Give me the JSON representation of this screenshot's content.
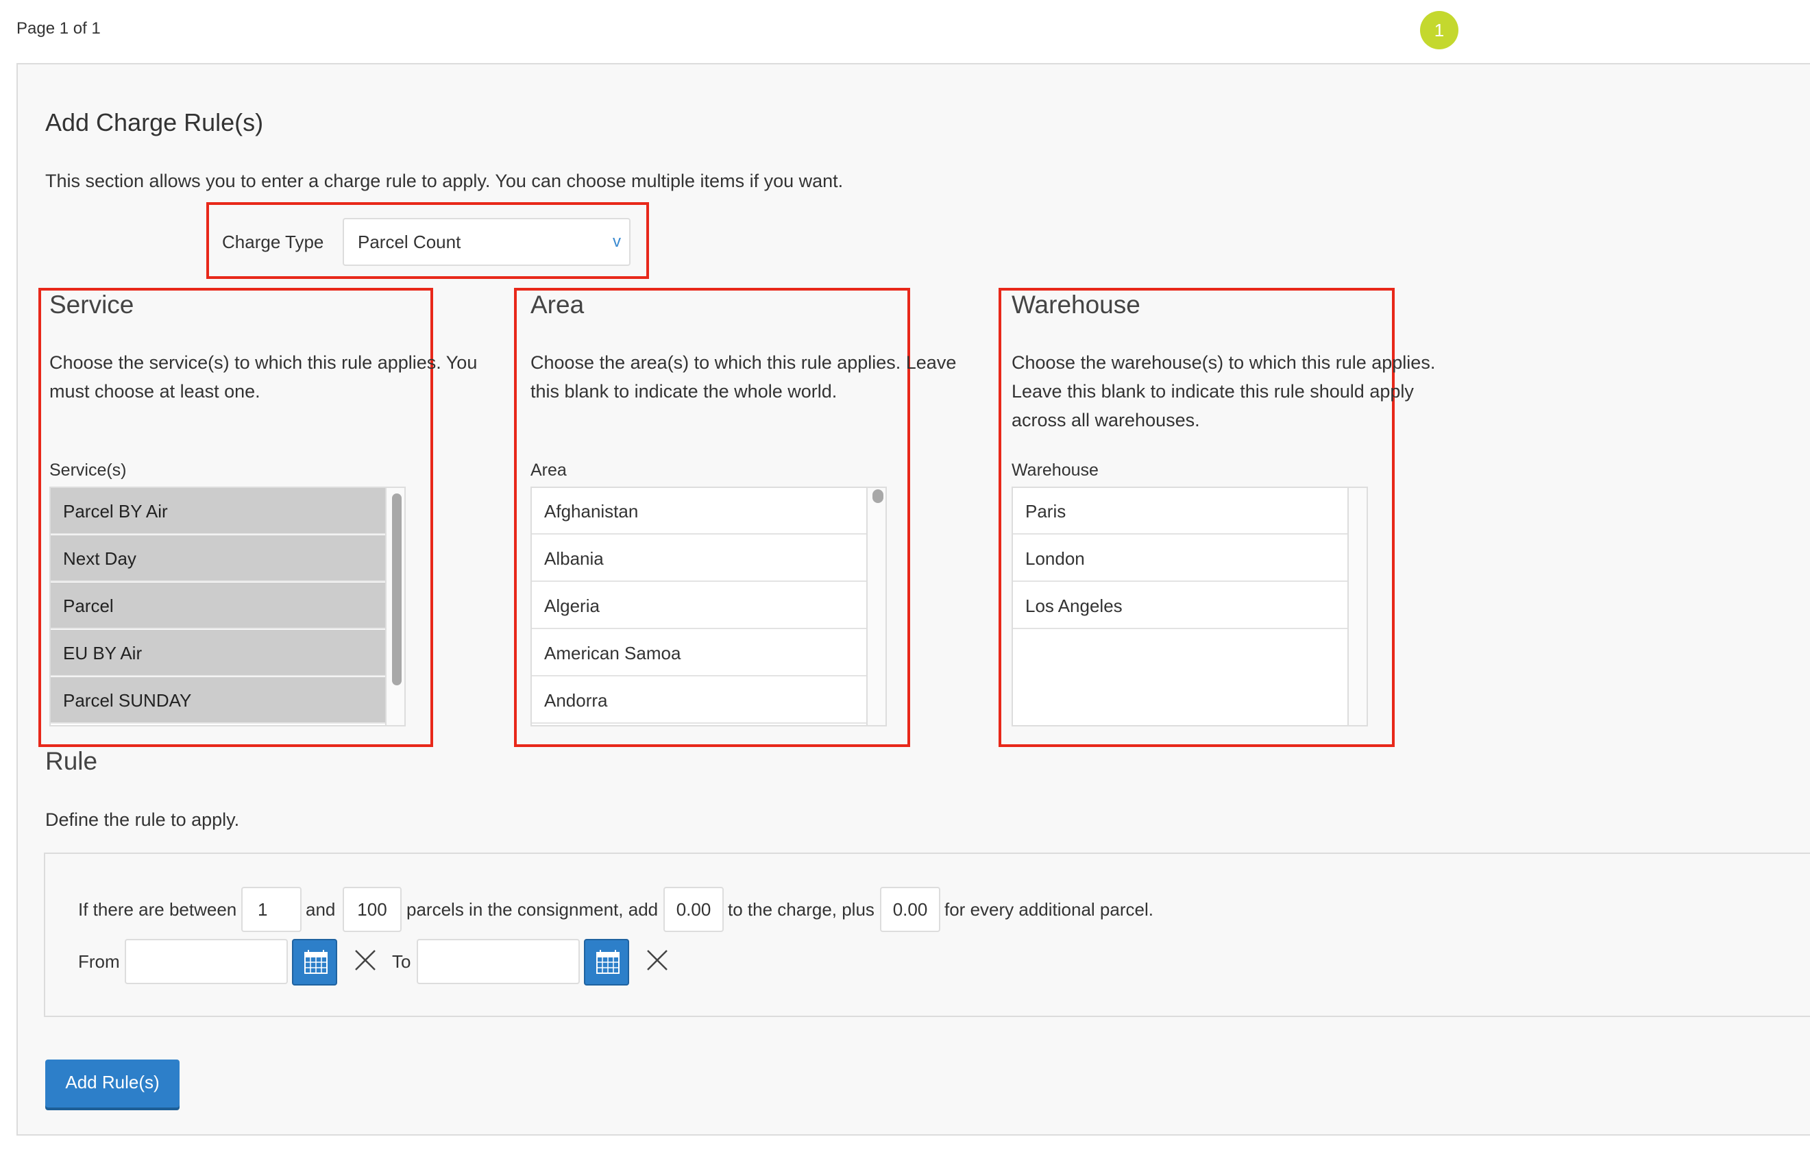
{
  "header": {
    "page_label": "Page 1 of 1",
    "step_number": "1"
  },
  "form": {
    "title": "Add Charge Rule(s)",
    "description": "This section allows you to enter a charge rule to apply. You can choose multiple items if you want.",
    "charge_type": {
      "label": "Charge Type",
      "value": "Parcel Count"
    }
  },
  "service": {
    "heading": "Service",
    "description_line1": "Choose the service(s) to which this rule applies. You",
    "description_line2": "must choose at least one.",
    "list_label": "Service(s)",
    "items": [
      "Parcel BY Air",
      "Next Day",
      "Parcel",
      "EU BY Air",
      "Parcel SUNDAY"
    ]
  },
  "area": {
    "heading": "Area",
    "description_line1": "Choose the area(s) to which this rule applies. Leave",
    "description_line2": "this blank to indicate the whole world.",
    "list_label": "Area",
    "items": [
      "Afghanistan",
      "Albania",
      "Algeria",
      "American Samoa",
      "Andorra"
    ]
  },
  "warehouse": {
    "heading": "Warehouse",
    "description_line1": "Choose the warehouse(s) to which this rule applies.",
    "description_line2": "Leave this blank to indicate this rule should apply",
    "description_line3": "across all warehouses.",
    "list_label": "Warehouse",
    "items": [
      "Paris",
      "London",
      "Los Angeles"
    ]
  },
  "rule": {
    "heading": "Rule",
    "description": "Define the rule to apply.",
    "text_if": "If there are between",
    "min_value": "1",
    "text_and": "and",
    "max_value": "100",
    "text_parcels": "parcels in the consignment, add",
    "charge_value": "0.00",
    "text_charge": "to the charge, plus",
    "additional_value": "0.00",
    "text_additional": "for every additional parcel.",
    "from_label": "From",
    "to_label": "To"
  },
  "actions": {
    "add_rules_label": "Add Rule(s)"
  },
  "colors": {
    "accent": "#2d7fc9",
    "highlight_box": "#e8281a",
    "step_badge": "#c4d82e",
    "selected_row": "#cccccc"
  }
}
